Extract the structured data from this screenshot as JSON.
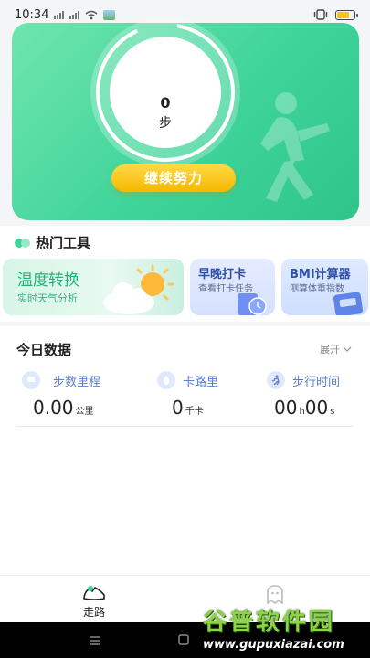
{
  "status_bar": {
    "time": "10:34"
  },
  "hero": {
    "step_count": "0",
    "step_unit": "步",
    "cta_label": "继续努力"
  },
  "hot_tools": {
    "title": "热门工具",
    "cards": [
      {
        "title": "温度转换",
        "subtitle": "实时天气分析"
      },
      {
        "title": "早晚打卡",
        "subtitle": "查看打卡任务"
      },
      {
        "title": "BMI计算器",
        "subtitle": "测算体重指数"
      }
    ]
  },
  "today": {
    "title": "今日数据",
    "expand_label": "展开",
    "stats": [
      {
        "label": "步数里程",
        "value": "0.00",
        "unit": "公里"
      },
      {
        "label": "卡路里",
        "value": "0",
        "unit": "千卡"
      },
      {
        "label": "步行时间",
        "value_h": "00",
        "unit_h": "h",
        "value_s": "00",
        "unit_s": "s"
      }
    ]
  },
  "tab_bar": {
    "tabs": [
      {
        "label": "走路"
      }
    ]
  },
  "watermark": {
    "title": "谷普软件园",
    "url": "www.gupuxiazai.com"
  },
  "colors": {
    "hero_green": "#3fd49a",
    "accent_yellow": "#f5b800",
    "stat_blue": "#5b7fd0",
    "battery": "#f5c518"
  }
}
